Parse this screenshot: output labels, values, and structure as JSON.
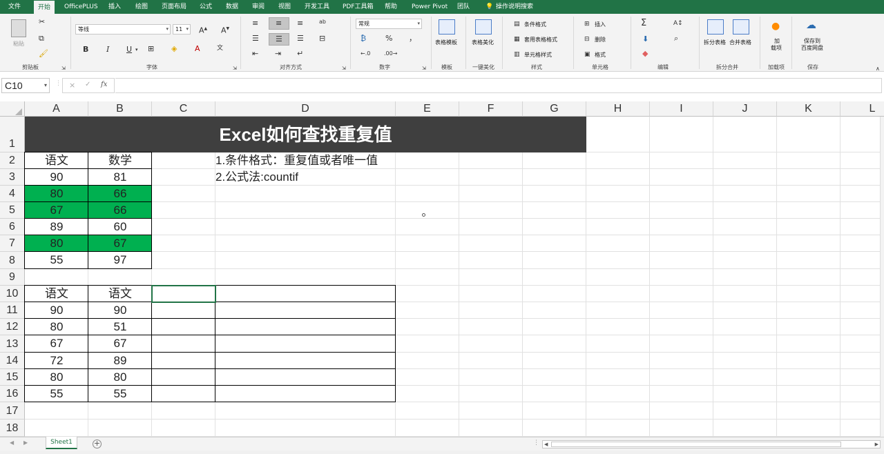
{
  "menu": {
    "tabs": [
      "文件",
      "开始",
      "OfficePLUS",
      "插入",
      "绘图",
      "页面布局",
      "公式",
      "数据",
      "审阅",
      "视图",
      "开发工具",
      "PDF工具箱",
      "帮助",
      "Power Pivot",
      "团队",
      "操作说明搜索"
    ],
    "active": "开始"
  },
  "ribbon": {
    "clipboard": {
      "paste": "粘贴",
      "group": "剪贴板"
    },
    "font": {
      "family": "等线",
      "size": "11",
      "group": "字体",
      "bold": "B",
      "italic": "I",
      "underline": "U"
    },
    "alignment": {
      "group": "对齐方式"
    },
    "number": {
      "format": "常规",
      "percent": "%",
      "comma": "，",
      "group": "数字"
    },
    "template": {
      "button": "表格模板",
      "group": "模板"
    },
    "beautify": {
      "button": "表格美化",
      "group": "一键美化"
    },
    "styles": {
      "conditional": "条件格式",
      "table": "套用表格格式",
      "cell": "单元格样式",
      "group": "样式"
    },
    "cells": {
      "insert": "插入",
      "delete": "删除",
      "format": "格式",
      "group": "单元格"
    },
    "editing": {
      "group": "编辑"
    },
    "split": {
      "split": "拆分表格",
      "merge": "合并表格",
      "group": "拆分合并"
    },
    "addins": {
      "button1": "加",
      "button2": "载项",
      "group": "加载项"
    },
    "save": {
      "button1": "保存到",
      "button2": "百度网盘",
      "group": "保存"
    }
  },
  "formula_bar": {
    "name_box": "C10",
    "fx": "fx",
    "cancel": "×",
    "enter": "✓",
    "formula": ""
  },
  "grid": {
    "columns": [
      "A",
      "B",
      "C",
      "D",
      "E",
      "F",
      "G",
      "H",
      "I",
      "J",
      "K",
      "L"
    ],
    "rows": [
      "1",
      "2",
      "3",
      "4",
      "5",
      "6",
      "7",
      "8",
      "9",
      "10",
      "11",
      "12",
      "13",
      "14",
      "15",
      "16",
      "17",
      "18"
    ],
    "title": "Excel如何查找重复值",
    "notes": [
      "1.条件格式：重复值或者唯一值",
      "2.公式法:countif"
    ],
    "table1": {
      "headers": [
        "语文",
        "数学"
      ],
      "rows": [
        [
          "90",
          "81"
        ],
        [
          "80",
          "66"
        ],
        [
          "67",
          "66"
        ],
        [
          "89",
          "60"
        ],
        [
          "80",
          "67"
        ],
        [
          "55",
          "97"
        ]
      ],
      "highlight_color": "#00b050"
    },
    "table2": {
      "headers": [
        "语文",
        "语文"
      ],
      "rows": [
        [
          "90",
          "90"
        ],
        [
          "80",
          "51"
        ],
        [
          "67",
          "67"
        ],
        [
          "72",
          "89"
        ],
        [
          "80",
          "80"
        ],
        [
          "55",
          "55"
        ]
      ]
    }
  },
  "sheet": {
    "tabs": [
      "Sheet1"
    ],
    "add": "+"
  },
  "colors": {
    "excel_green": "#217346",
    "title_bg": "#3f3f3f",
    "highlight": "#00b050"
  }
}
